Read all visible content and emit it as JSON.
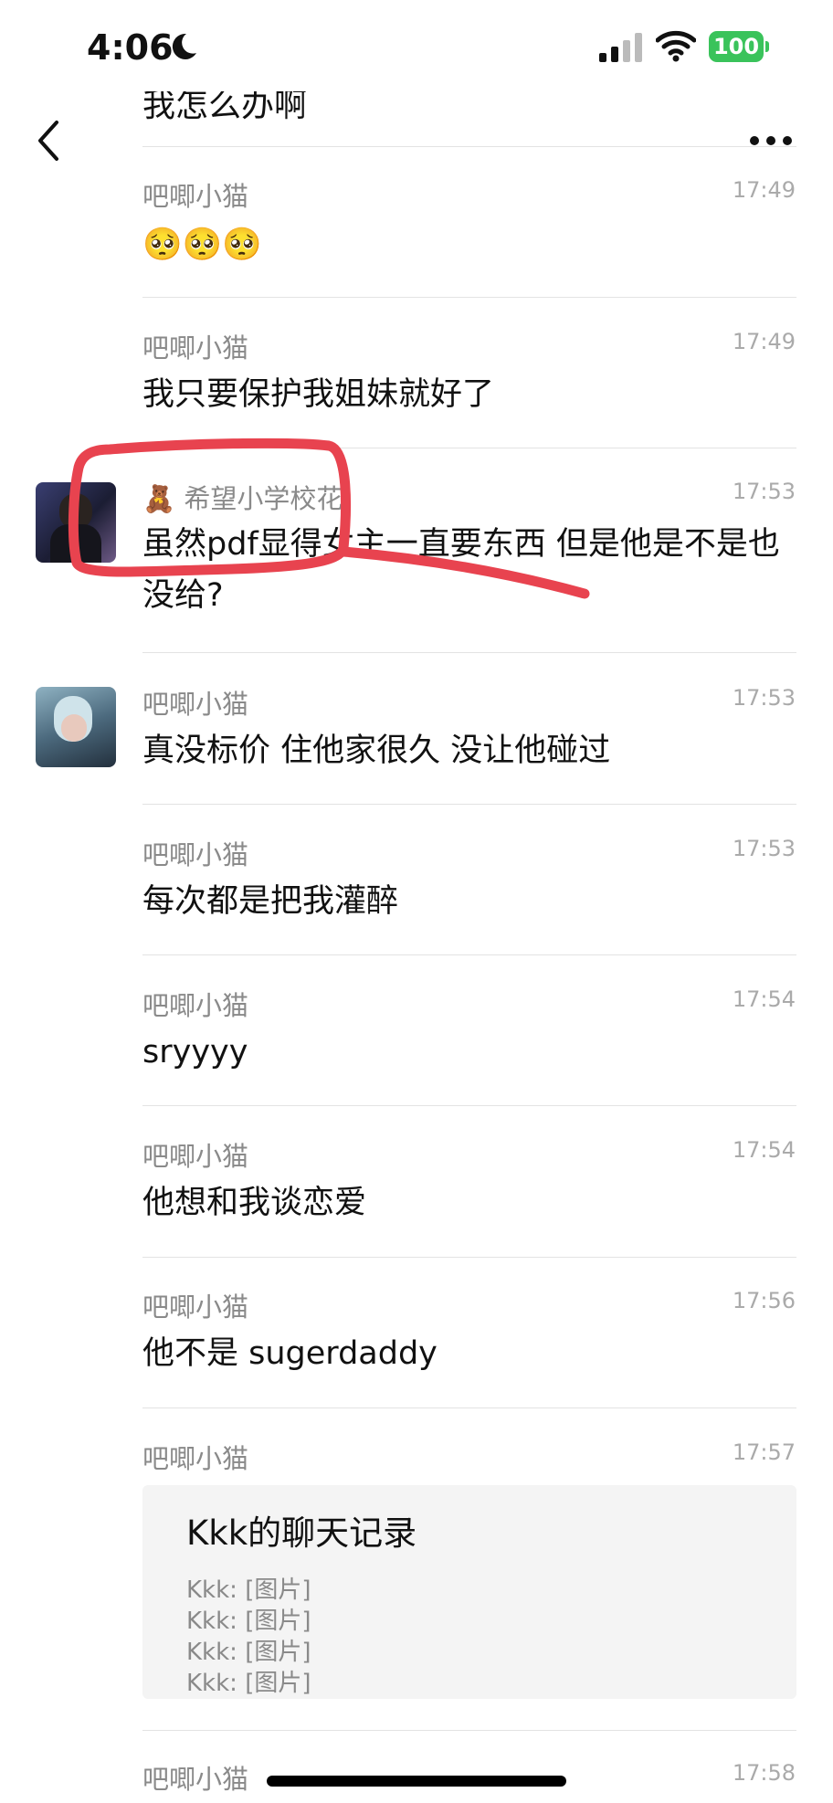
{
  "status_bar": {
    "time": "4:06",
    "battery": "100"
  },
  "header": {
    "partial_text": "我怎么办啊"
  },
  "messages": [
    {
      "name": "吧唧小猫",
      "time": "17:49",
      "text": "🥺🥺🥺"
    },
    {
      "name": "吧唧小猫",
      "time": "17:49",
      "text": "我只要保护我姐妹就好了"
    },
    {
      "name": "希望小学校花",
      "name_emoji": "🧸",
      "time": "17:53",
      "text": "虽然pdf显得女主一直要东西 但是他是不是也没给?"
    },
    {
      "name": "吧唧小猫",
      "time": "17:53",
      "text": "真没标价 住他家很久 没让他碰过"
    },
    {
      "name": "吧唧小猫",
      "time": "17:53",
      "text": "每次都是把我灌醉"
    },
    {
      "name": "吧唧小猫",
      "time": "17:54",
      "text": "sryyyy"
    },
    {
      "name": "吧唧小猫",
      "time": "17:54",
      "text": "他想和我谈恋爱"
    },
    {
      "name": "吧唧小猫",
      "time": "17:56",
      "text": "他不是 sugerdaddy"
    },
    {
      "name": "吧唧小猫",
      "time": "17:57"
    },
    {
      "name": "吧唧小猫",
      "time": "17:58"
    }
  ],
  "chat_record_card": {
    "title": "Kkk的聊天记录",
    "lines": [
      "Kkk: [图片]",
      "Kkk: [图片]",
      "Kkk: [图片]",
      "Kkk: [图片]"
    ]
  },
  "colors": {
    "annotation": "#e8434f",
    "battery": "#3ac35b",
    "name": "#8a8a8a",
    "time": "#aaaaaa"
  }
}
